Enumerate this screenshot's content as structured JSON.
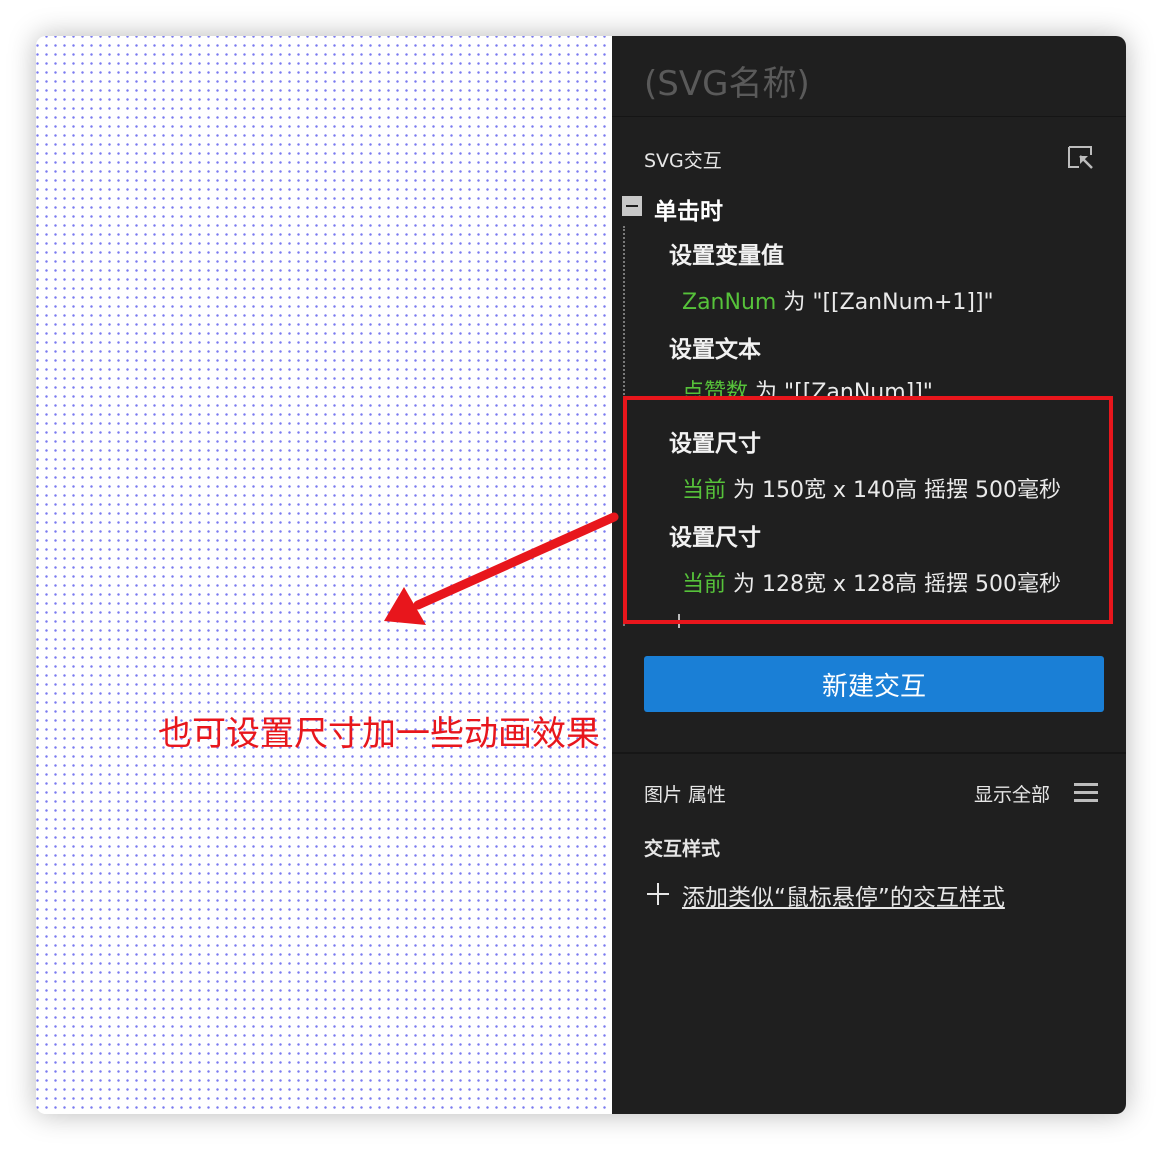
{
  "panel": {
    "title": "(SVG名称)",
    "section_label": "SVG交互",
    "expand_icon": "collapse-arrow-icon"
  },
  "interaction": {
    "event": "单击时",
    "actions": [
      {
        "title": "设置变量值",
        "target": "ZanNum",
        "op": "为",
        "value": "\"[[ZanNum+1]]\""
      },
      {
        "title": "设置文本",
        "target": "点赞数",
        "op": "为",
        "value": "\"[[ZanNum]]\""
      },
      {
        "title": "设置尺寸",
        "target": "当前",
        "op": "为",
        "value": "150宽 x 140高 摇摆 500毫秒"
      },
      {
        "title": "设置尺寸",
        "target": "当前",
        "op": "为",
        "value": "128宽 x 128高 摇摆 500毫秒"
      }
    ]
  },
  "new_button": "新建交互",
  "properties": {
    "label": "图片 属性",
    "show_all": "显示全部",
    "menu_icon": "hamburger-menu-icon"
  },
  "interaction_styles": {
    "label": "交互样式",
    "add_link": "添加类似“鼠标悬停”的交互样式",
    "plus_icon": "plus-icon"
  },
  "annotation": {
    "text": "也可设置尺寸加一些动画效果"
  },
  "colors": {
    "panel_bg": "#1f1f1f",
    "accent_button": "#1a7fd6",
    "target_green": "#56c23a",
    "annotation_red": "#e8161c",
    "canvas_dots": "#7b7bf0"
  }
}
